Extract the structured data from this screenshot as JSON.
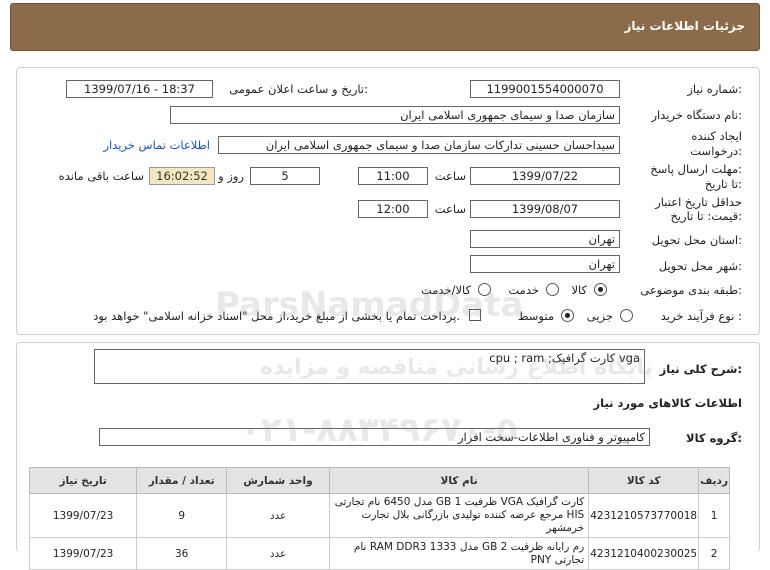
{
  "header": {
    "title": "جزئیات اطلاعات نیاز"
  },
  "form": {
    "need_number_label": "شماره نیاز:",
    "need_number": "1199001554000070",
    "announce_label": "تاریخ و ساعت اعلان عمومی:",
    "announce_value": "1399/07/16 - 18:37",
    "buyer_org_label": "نام دستگاه خریدار:",
    "buyer_org": "سازمان صدا و سیمای جمهوری اسلامی ایران",
    "creator_label_1": "ایجاد کننده",
    "creator_label_2": "درخواست:",
    "creator": "سیداحسان حسینی تدارکات سازمان صدا و سیمای جمهوری اسلامی ایران",
    "contact_link": "اطلاعات تماس خریدار",
    "deadline_label_1": "مهلت ارسال پاسخ:",
    "deadline_label_2": "تا تاریخ:",
    "deadline_date": "1399/07/22",
    "time_label": "ساعت",
    "deadline_time": "11:00",
    "days_value": "5",
    "days_label": "روز و",
    "remaining_time": "16:02:52",
    "remaining_label": "ساعت باقی مانده",
    "validity_label_1": "حداقل تاریخ اعتبار",
    "validity_label_2": "قیمت: تا تاریخ:",
    "validity_date": "1399/08/07",
    "validity_time": "12:00",
    "province_label": "استان محل تحویل:",
    "province": "تهران",
    "city_label": "شهر محل تحویل:",
    "city": "تهران",
    "category_label": "طبقه بندی موضوعی:",
    "category_options": [
      "کالا",
      "خدمت",
      "کالا/خدمت"
    ],
    "category_selected": "کالا",
    "process_label": "نوع فرآیند خرید :",
    "process_options": [
      "جزیی",
      "متوسط"
    ],
    "process_selected": "متوسط",
    "payment_note": "پرداخت تمام یا بخشی از مبلغ خرید،از محل \"اسناد خزانه اسلامی\" خواهد بود."
  },
  "summary": {
    "label": "شرح کلی نیاز:",
    "value": "cpu ; ram ;کارت گرافیک vga"
  },
  "goods": {
    "section_title": "اطلاعات کالاهای مورد نیاز",
    "group_label": "گروه کالا:",
    "group_value": "کامپیوتر و فناوری اطلاعات-سخت افزار",
    "columns": [
      "ردیف",
      "کد کالا",
      "نام کالا",
      "واحد شمارش",
      "تعداد / مقدار",
      "تاریخ نیاز"
    ],
    "rows": [
      {
        "row": "1",
        "code": "4231210573770018",
        "name": "کارت گرافیک VGA ظرفیت 1 GB مدل 6450 نام تجارتی HIS مرجع عرضه کننده تولیدی بازرگانی بلال تجارت خرمشهر",
        "unit": "عدد",
        "qty": "9",
        "date": "1399/07/23"
      },
      {
        "row": "2",
        "code": "4231210400230025",
        "name": "رم رایانه ظرفیت 2 GB مدل RAM DDR3 1333 نام تجارتی PNY",
        "unit": "عدد",
        "qty": "36",
        "date": "1399/07/23"
      }
    ]
  },
  "watermark": {
    "line1": "ParsNamadData",
    "line2": "پایگاه اطلاع رسانی مناقصه و مزایده",
    "line3": "۰۲۱-۸۸۳۴۹۶۷۰-۵"
  }
}
